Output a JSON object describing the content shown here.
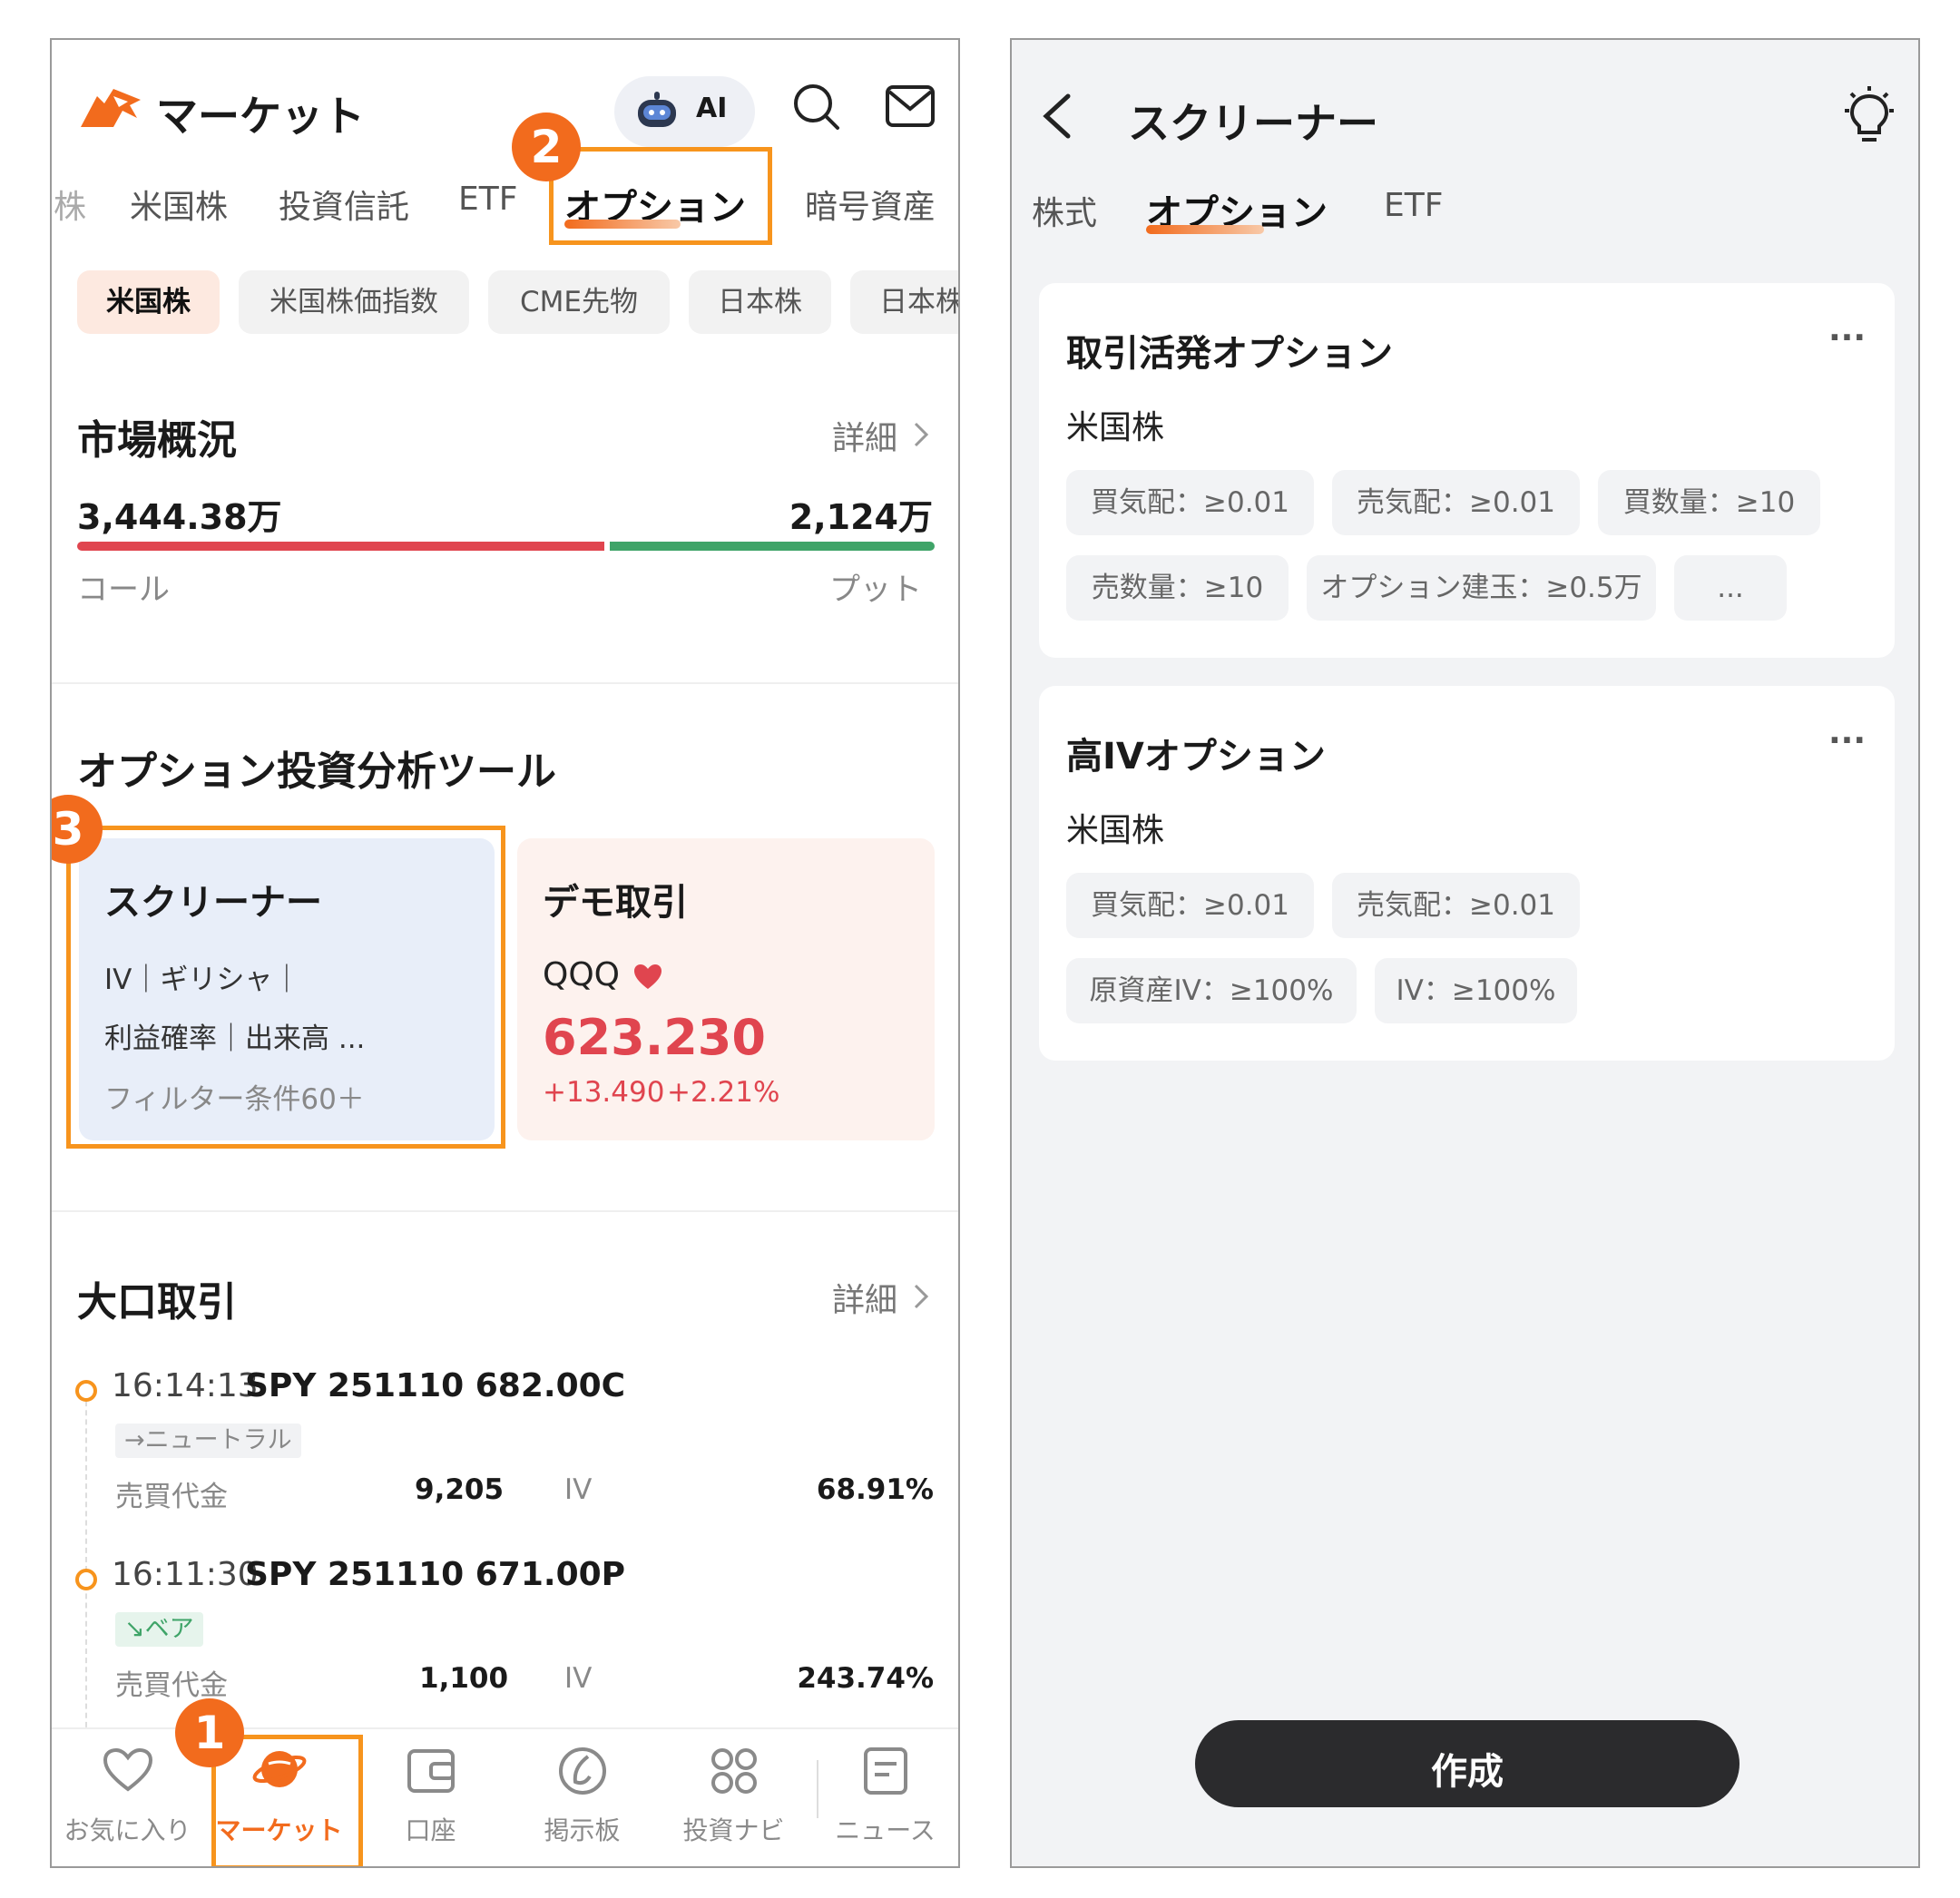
{
  "left": {
    "header": {
      "title": "マーケット",
      "ai_label": "AI"
    },
    "tabs": [
      "株",
      "米国株",
      "投資信託",
      "ETF",
      "オプション",
      "暗号資産"
    ],
    "subtabs": [
      "米国株",
      "米国株価指数",
      "CME先物",
      "日本株",
      "日本株"
    ],
    "market": {
      "title": "市場概況",
      "detail": "詳細",
      "call_value": "3,444.38万",
      "put_value": "2,124万",
      "call_label": "コール",
      "put_label": "プット",
      "call_ratio": 0.618
    },
    "tools": {
      "title": "オプション投資分析ツール",
      "screener": {
        "title": "スクリーナー",
        "line1": "IV｜ギリシャ｜",
        "line2": "利益確率｜出来高 ...",
        "line3": "フィルター条件60＋"
      },
      "demo": {
        "title": "デモ取引",
        "symbol": "QQQ",
        "price": "623.230",
        "change": "+13.490",
        "change_pct": "+2.21%"
      }
    },
    "block": {
      "title": "大口取引",
      "detail": "詳細",
      "trades": [
        {
          "time": "16:14:13",
          "contract": "SPY 251110 682.00C",
          "tag": "→ニュートラル",
          "amount_label": "売買代金",
          "amount": "9,205",
          "iv_label": "IV",
          "iv": "68.91%"
        },
        {
          "time": "16:11:30",
          "contract": "SPY 251110 671.00P",
          "tag": "↘ベア",
          "amount_label": "売買代金",
          "amount": "1,100",
          "iv_label": "IV",
          "iv": "243.74%"
        }
      ]
    },
    "nav": [
      "お気に入り",
      "マーケット",
      "口座",
      "掲示板",
      "投資ナビ",
      "ニュース"
    ],
    "badges": [
      "1",
      "2",
      "3"
    ]
  },
  "right": {
    "header": {
      "title": "スクリーナー"
    },
    "tabs": [
      "株式",
      "オプション",
      "ETF"
    ],
    "cards": [
      {
        "title": "取引活発オプション",
        "market": "米国株",
        "more": "···",
        "chips": [
          "買気配：≥0.01",
          "売気配：≥0.01",
          "買数量：≥10",
          "売数量：≥10",
          "オプション建玉：≥0.5万",
          "..."
        ]
      },
      {
        "title": "高IVオプション",
        "market": "米国株",
        "more": "···",
        "chips": [
          "買気配：≥0.01",
          "売気配：≥0.01",
          "原資産IV：≥100%",
          "IV：≥100%"
        ]
      }
    ],
    "create_button": "作成"
  },
  "colors": {
    "accent": "#f26b1d",
    "call": "#e0454f",
    "put": "#3fa468",
    "price_up": "#e0454f"
  }
}
